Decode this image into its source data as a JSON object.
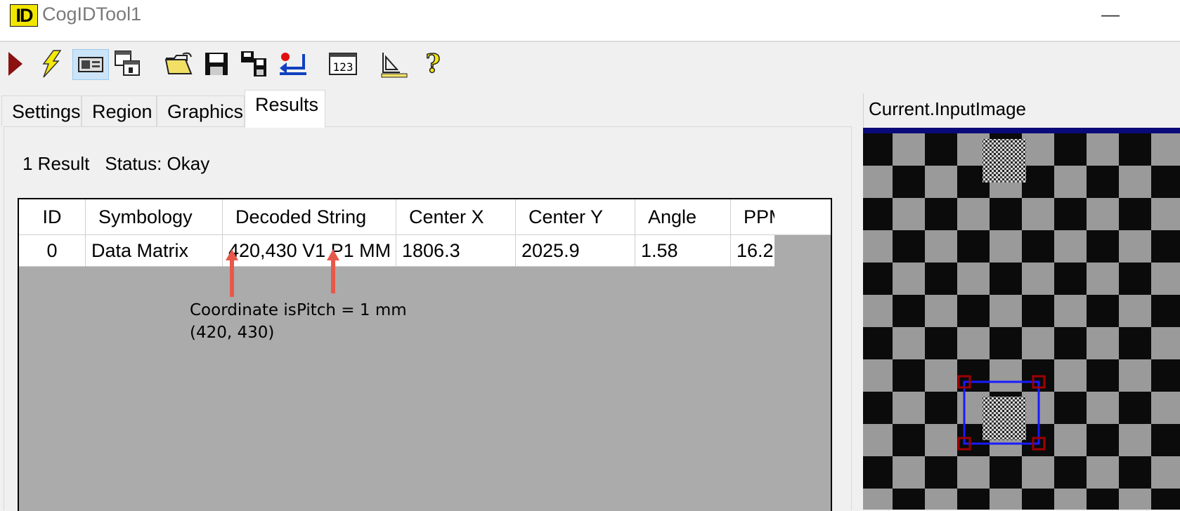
{
  "window": {
    "logo_text": "ID",
    "title": "CogIDTool1"
  },
  "toolbar": {
    "buttons": [
      {
        "name": "run-icon"
      },
      {
        "name": "lightning-icon"
      },
      {
        "name": "show-image-icon"
      },
      {
        "name": "floating-window-icon"
      },
      {
        "name": "open-folder-icon"
      },
      {
        "name": "save-icon"
      },
      {
        "name": "save-settings-icon"
      },
      {
        "name": "reset-icon"
      },
      {
        "name": "numeric-display-icon"
      },
      {
        "name": "calibration-icon"
      },
      {
        "name": "help-icon"
      }
    ],
    "numeric_label": "123"
  },
  "tabs": [
    {
      "label": "Settings",
      "selected": false
    },
    {
      "label": "Region",
      "selected": false
    },
    {
      "label": "Graphics",
      "selected": false
    },
    {
      "label": "Results",
      "selected": true
    }
  ],
  "results": {
    "count_text": "1 Result",
    "status_text": "Status: Okay",
    "columns": [
      "ID",
      "Symbology",
      "Decoded String",
      "Center X",
      "Center Y",
      "Angle",
      "PPM"
    ],
    "rows": [
      {
        "id": "0",
        "symbology": "Data Matrix",
        "decoded": "420,430 V1 P1 MM",
        "center_x": "1806.3",
        "center_y": "2025.9",
        "angle": "1.58",
        "ppm": "16.2"
      }
    ]
  },
  "annotations": {
    "coordinate_line1": "Coordinate is",
    "coordinate_line2": "(420, 430)",
    "pitch": "Pitch = 1 mm",
    "arrow_color": "#e8584a"
  },
  "image_panel": {
    "title": "Current.InputImage",
    "selection_color": "#1a1aff",
    "handle_color": "#a00000"
  }
}
